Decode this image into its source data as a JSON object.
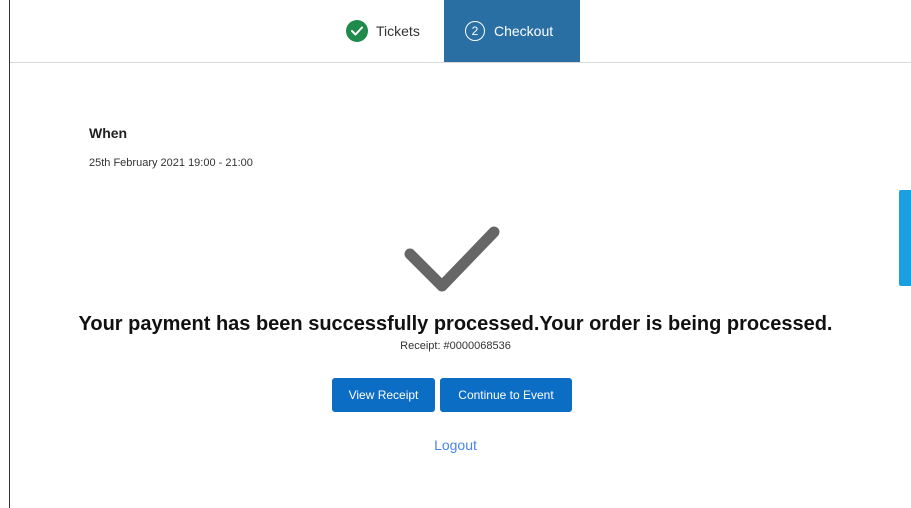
{
  "tabs": {
    "tickets_label": "Tickets",
    "checkout_label": "Checkout",
    "checkout_step": "2"
  },
  "event": {
    "when_label": "When",
    "when_value": "25th February 2021 19:00 - 21:00"
  },
  "confirmation": {
    "message": "Your payment has been successfully processed.Your order is being processed.",
    "receipt": "Receipt: #0000068536"
  },
  "actions": {
    "view_receipt": "View Receipt",
    "continue_to_event": "Continue to Event",
    "logout": "Logout"
  },
  "icons": {
    "tickets_step": "check-circle-icon",
    "success": "checkmark-icon"
  },
  "colors": {
    "active_tab": "#2a6fa4",
    "step_complete": "#1f8a4c",
    "button": "#0b6dc4",
    "link": "#4a86e8",
    "side_accent": "#1a9fe0"
  }
}
